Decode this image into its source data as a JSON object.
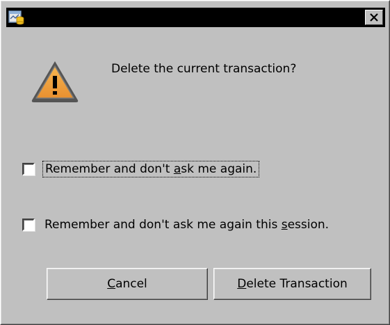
{
  "dialog": {
    "message": "Delete the current transaction?",
    "icons": {
      "app": "app-icon",
      "close": "close-icon",
      "warning": "warning-icon"
    }
  },
  "options": [
    {
      "pre": "Remember and don't ",
      "mnemonic": "a",
      "post": "sk me again.",
      "checked": false
    },
    {
      "pre": "Remember and don't ask me again this ",
      "mnemonic": "s",
      "post": "ession.",
      "checked": false
    }
  ],
  "buttons": {
    "cancel": {
      "mnemonic": "C",
      "rest": "ancel"
    },
    "delete": {
      "mnemonic": "D",
      "rest": "elete Transaction"
    }
  },
  "colors": {
    "titlebar": "#000000",
    "face": "#c0c0c0",
    "warning_fill": "#f0a040"
  }
}
